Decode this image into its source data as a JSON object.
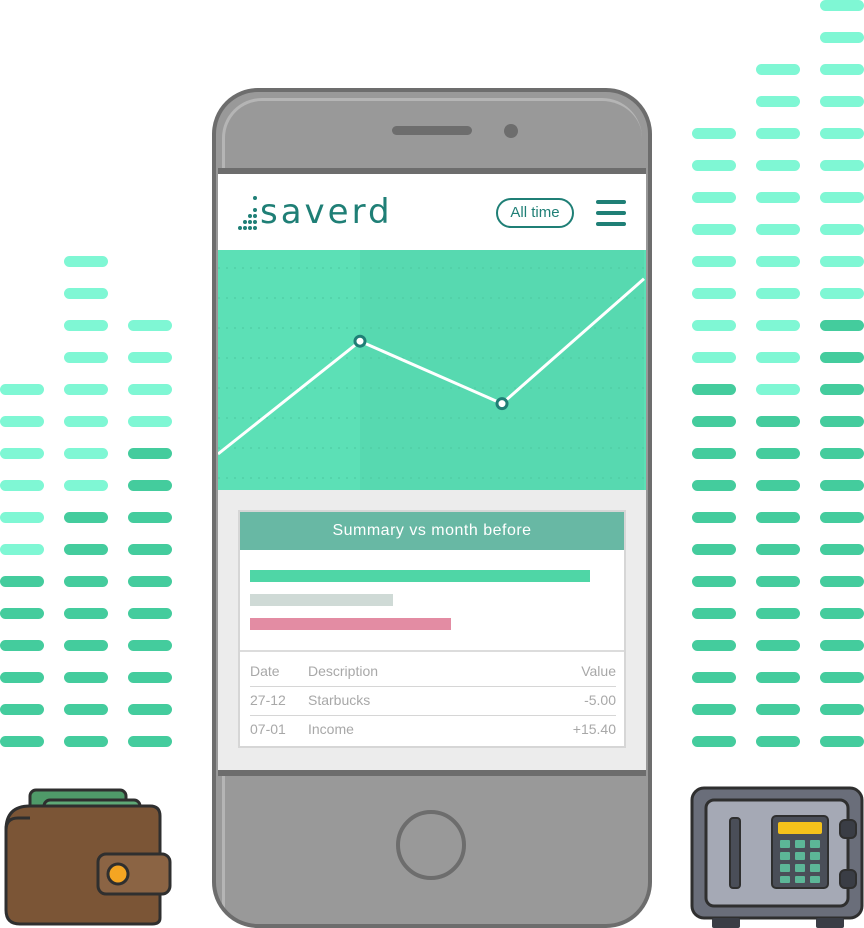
{
  "app": {
    "logo_text": "saverd",
    "filter_label": "All time",
    "summary_title": "Summary vs month before"
  },
  "colors": {
    "brand": "#1f7f76",
    "chart_bg": "#5ce0b6",
    "bar_income": "#4fd6a6",
    "bar_neutral": "#cfdad6",
    "bar_expense": "#e38ca3",
    "eq_light": "#7ff7d4",
    "eq_dark": "#44cc9d"
  },
  "chart_data": {
    "type": "line",
    "x": [
      0,
      1,
      2,
      3
    ],
    "series": [
      {
        "values": [
          0.15,
          0.62,
          0.36,
          0.88
        ]
      }
    ],
    "markers_at": [
      1,
      2
    ]
  },
  "summary": {
    "bars": [
      {
        "kind": "income",
        "fraction": 0.93
      },
      {
        "kind": "neutral",
        "fraction": 0.39
      },
      {
        "kind": "expense",
        "fraction": 0.55
      }
    ]
  },
  "table": {
    "columns": {
      "date": "Date",
      "description": "Description",
      "value": "Value"
    },
    "rows": [
      {
        "date": "27-12",
        "description": "Starbucks",
        "value": "-5.00"
      },
      {
        "date": "07-01",
        "description": "Income",
        "value": "+15.40"
      }
    ]
  },
  "equalizer": {
    "left": [
      {
        "light": 6,
        "dark": 6
      },
      {
        "light": 8,
        "dark": 8
      },
      {
        "light": 4,
        "dark": 10
      }
    ],
    "right": [
      {
        "light": 8,
        "dark": 12
      },
      {
        "light": 11,
        "dark": 11
      },
      {
        "light": 10,
        "dark": 14
      }
    ]
  },
  "icons": {
    "wallet": "wallet-icon",
    "safe": "safe-icon",
    "menu": "hamburger-menu-icon"
  }
}
